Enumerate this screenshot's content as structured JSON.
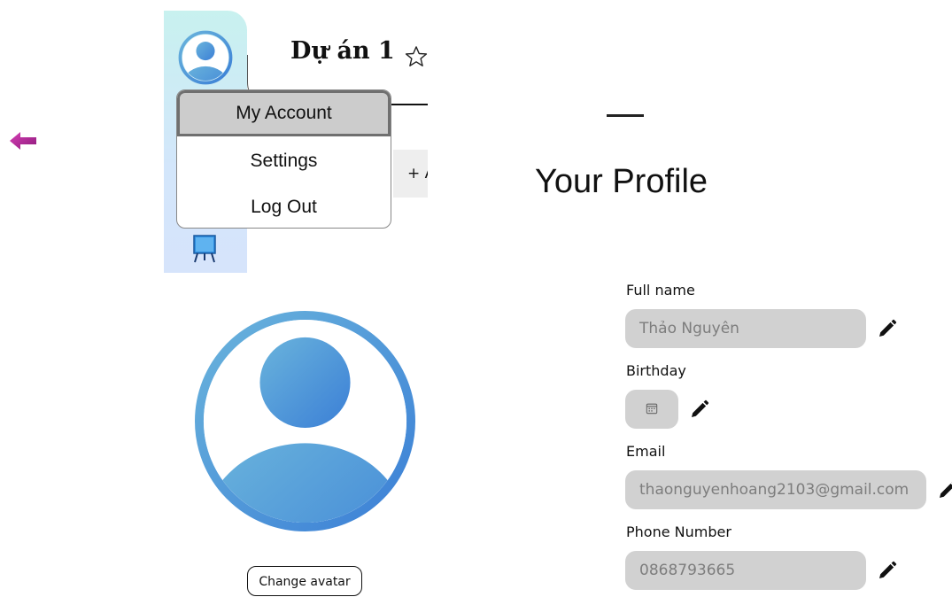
{
  "thumbnail": {
    "project_title": "Dự án 1",
    "add_button_label": "+ A"
  },
  "account_menu": {
    "items": [
      {
        "label": "My Account",
        "selected": true
      },
      {
        "label": "Settings",
        "selected": false
      },
      {
        "label": "Log Out",
        "selected": false
      }
    ]
  },
  "profile": {
    "title": "Your Profile",
    "change_avatar_label": "Change avatar",
    "fields": {
      "full_name": {
        "label": "Full name",
        "value": "Thảo Nguyên"
      },
      "birthday": {
        "label": "Birthday",
        "value": ""
      },
      "email": {
        "label": "Email",
        "value": "thaonguyenhoang2103@gmail.com"
      },
      "phone": {
        "label": "Phone Number",
        "value": "0868793665"
      }
    }
  },
  "icons": {
    "back": "back-arrow-icon",
    "star": "star-icon",
    "edit": "pencil-icon",
    "calendar": "calendar-icon",
    "avatar": "user-avatar-icon",
    "board": "board-icon"
  },
  "colors": {
    "back_arrow": "#b5299c",
    "avatar_light": "#6ab4dc",
    "avatar_dark": "#3b7fd6",
    "input_bg": "#d1d1d1",
    "menu_selected_bg": "#cccccc"
  }
}
